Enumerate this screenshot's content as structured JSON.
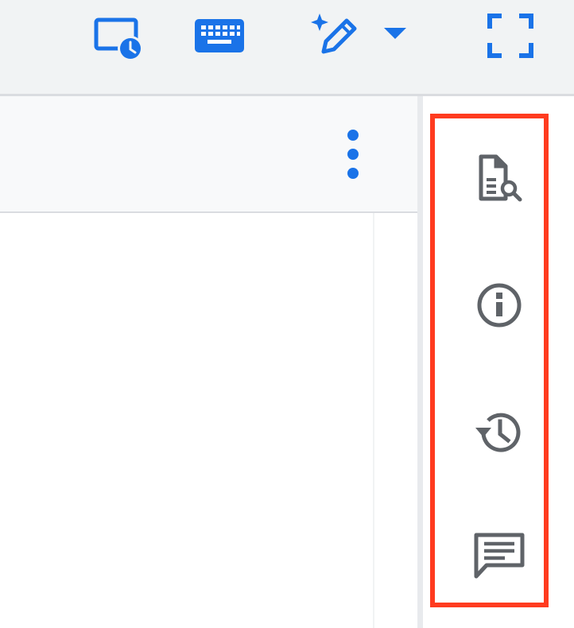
{
  "toolbar": {
    "icons": [
      "schedule-screen-icon",
      "keyboard-icon",
      "ai-pen-icon",
      "dropdown-arrow-icon",
      "fullscreen-icon"
    ],
    "accent_color": "#1a73e8"
  },
  "side_panel": {
    "icons": [
      "document-search-icon",
      "info-icon",
      "history-icon",
      "comment-icon"
    ],
    "icon_color": "#5f6368",
    "highlight_color": "#ff3b1f"
  }
}
